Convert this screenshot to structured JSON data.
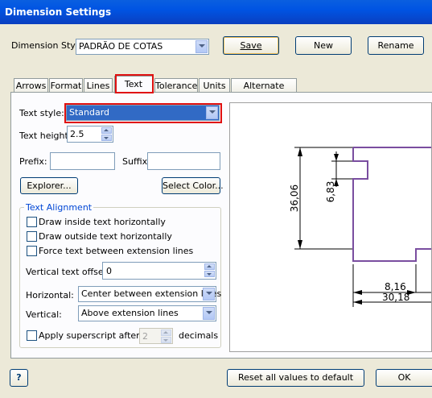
{
  "window": {
    "title": "Dimension Settings"
  },
  "dimension_style": {
    "label": "Dimension Style:",
    "value": "PADRÃO DE COTAS"
  },
  "buttons": {
    "save": "Save",
    "new": "New",
    "rename": "Rename",
    "explorer": "Explorer...",
    "select_color": "Select Color...",
    "reset": "Reset all values to default",
    "ok": "OK",
    "help": "?"
  },
  "tabs": [
    "Arrows",
    "Format",
    "Lines",
    "Text",
    "Tolerance",
    "Units",
    "Alternate Units"
  ],
  "text_tab": {
    "text_style": {
      "label": "Text style:",
      "value": "Standard"
    },
    "text_height": {
      "label": "Text height:",
      "value": "2.5"
    },
    "prefix": {
      "label": "Prefix:",
      "value": ""
    },
    "suffix": {
      "label": "Suffix:",
      "value": ""
    },
    "alignment": {
      "title": "Text Alignment",
      "draw_inside": "Draw inside text horizontally",
      "draw_outside": "Draw outside text horizontally",
      "force_between": "Force text between extension lines",
      "vertical_offset": {
        "label": "Vertical text offset:",
        "value": "0"
      },
      "horizontal": {
        "label": "Horizontal:",
        "value": "Center between extension lines"
      },
      "vertical": {
        "label": "Vertical:",
        "value": "Above extension lines"
      },
      "superscript": {
        "label": "Apply superscript after",
        "value": "2",
        "suffix": "decimals"
      }
    }
  },
  "preview": {
    "dim_36": "36,06",
    "dim_6": "6,83",
    "dim_8": "8,16",
    "dim_30": "30,18",
    "outline_color": "#7a4ea0"
  }
}
